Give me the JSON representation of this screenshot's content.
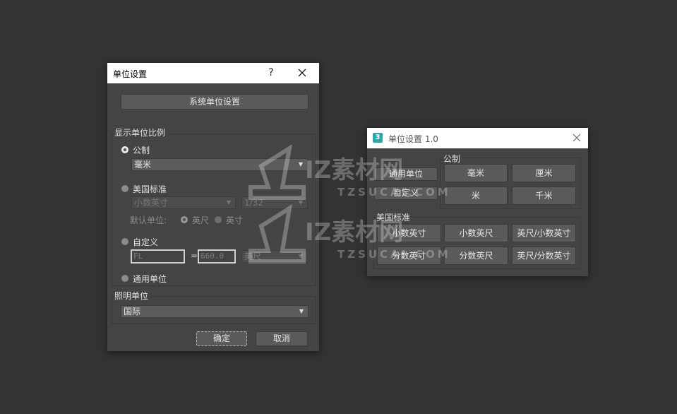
{
  "dialog1": {
    "title": "单位设置",
    "help_label": "?",
    "system_button": "系统单位设置",
    "display_group_label": "显示单位比例",
    "metric": {
      "label": "公制",
      "selected": true,
      "unit": "毫米"
    },
    "us": {
      "label": "美国标准",
      "selected": false,
      "unit": "小数英寸",
      "fraction": "1/32",
      "default_units_label": "默认单位:",
      "opt_feet": "英尺",
      "opt_inches": "英寸",
      "opt_feet_selected": true
    },
    "custom": {
      "label": "自定义",
      "selected": false,
      "name_value": "FL",
      "equals": "=",
      "amount_value": "660.0",
      "unit": "英尺"
    },
    "generic": {
      "label": "通用单位",
      "selected": false
    },
    "lighting_group_label": "照明单位",
    "lighting_unit": "国际",
    "ok_label": "确定",
    "cancel_label": "取消"
  },
  "dialog2": {
    "app_icon": "3",
    "title": "单位设置 1.0",
    "generic_button": "通用单位",
    "custom_button": "自定义",
    "metric_group_label": "公制",
    "metric_buttons": [
      "毫米",
      "厘米",
      "米",
      "千米"
    ],
    "us_group_label": "美国标准",
    "us_buttons_row1": [
      "小数英寸",
      "小数英尺",
      "英尺/小数英寸"
    ],
    "us_buttons_row2": [
      "分数英寸",
      "分数英尺",
      "英尺/分数英寸"
    ]
  },
  "watermark": {
    "brand": "IZ素材网",
    "domain": "TZSUCAI.COM"
  },
  "colors": {
    "desktop_bg": "#333333",
    "dialog_bg": "#444444",
    "button_bg": "#5a5a5a",
    "titlebar_bg": "#ffffff",
    "app_icon": "#2aa7b0"
  }
}
